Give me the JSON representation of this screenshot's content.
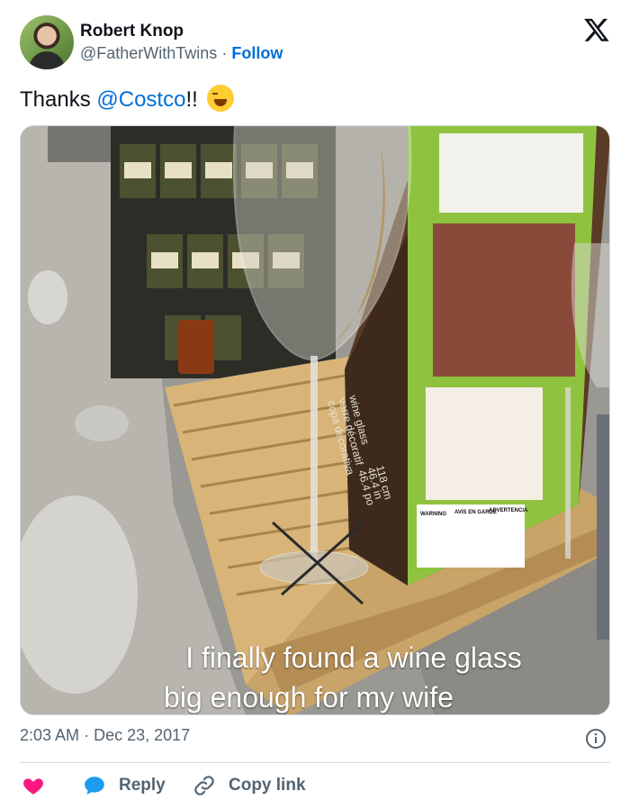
{
  "header": {
    "display_name": "Robert Knop",
    "handle": "@FatherWithTwins",
    "separator": "·",
    "follow_label": "Follow"
  },
  "tweet": {
    "text_prefix": "Thanks ",
    "mention": "@Costco",
    "text_suffix": "!!",
    "emoji_name": "face-with-tears-of-joy"
  },
  "media": {
    "caption_line1": "I finally found a wine glass",
    "caption_line2": "big enough for my wife",
    "box_text": [
      "wine glass",
      "verre décoratif",
      "copa decorativa",
      "118 cm",
      "46.4 in",
      "46.4 po"
    ],
    "warning_labels": [
      "WARNING",
      "AVIS EN GARDE",
      "ADVERTENCIA"
    ]
  },
  "meta": {
    "time": "2:03 AM",
    "separator": "·",
    "date": "Dec 23, 2017"
  },
  "actions": {
    "reply_label": "Reply",
    "copy_label": "Copy link"
  },
  "colors": {
    "link": "#006fd6",
    "heart": "#f91880",
    "reply_bubble": "#1d9bf0",
    "secondary_text": "#536471"
  }
}
